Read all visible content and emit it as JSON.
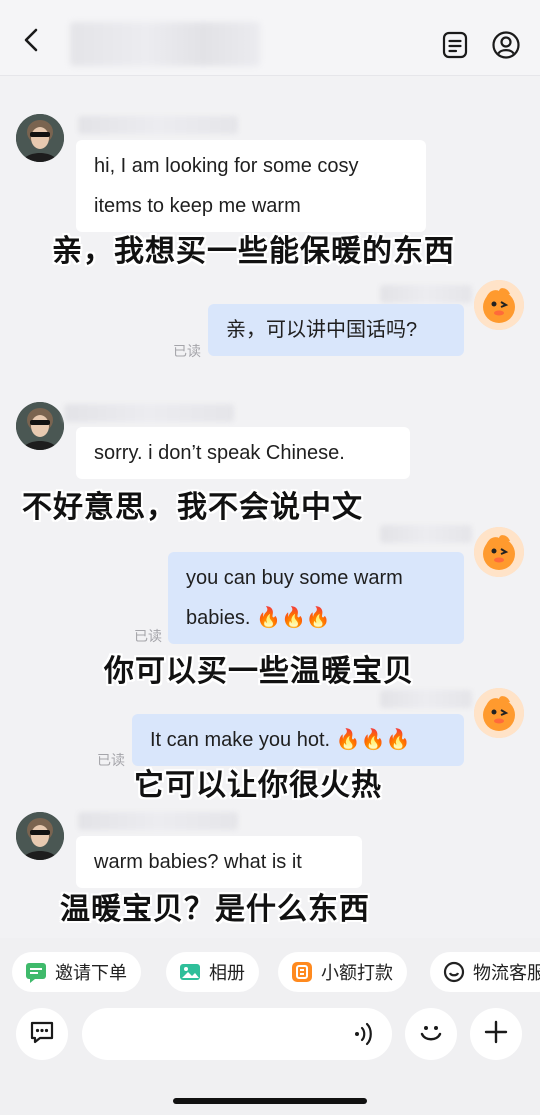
{
  "header": {
    "contact_name": ""
  },
  "messages": [
    {
      "side": "left",
      "text_line1": "hi, I am looking for some cosy",
      "text_line2": "items to keep me warm",
      "caption": "亲，我想买一些能保暖的东西"
    },
    {
      "side": "right",
      "text": "亲，可以讲中国话吗?",
      "read": "已读"
    },
    {
      "side": "left",
      "text": "sorry. i don’t speak Chinese.",
      "caption": "不好意思，我不会说中文"
    },
    {
      "side": "right",
      "text_line1": "you can buy some warm",
      "text_line2": "babies. 🔥🔥🔥",
      "read": "已读",
      "caption": "你可以买一些温暖宝贝"
    },
    {
      "side": "right",
      "text": "It can make you hot. 🔥🔥🔥",
      "read": "已读",
      "caption": "它可以让你很火热"
    },
    {
      "side": "left",
      "text": "warm babies? what is it",
      "caption": "温暖宝贝？是什么东西"
    }
  ],
  "quick_actions": [
    {
      "label": "邀请下单",
      "icon": "invite-order-icon",
      "color": "#3fba6b"
    },
    {
      "label": "相册",
      "icon": "photo-album-icon",
      "color": "#2fbf9a"
    },
    {
      "label": "小额打款",
      "icon": "small-payment-icon",
      "color": "#ff8a1f"
    },
    {
      "label": "物流客服",
      "icon": "logistics-service-icon",
      "color": "#222222"
    }
  ],
  "colors": {
    "bubble_right": "#d9e6fb",
    "bubble_left": "#ffffff",
    "background": "#f2f2f4"
  }
}
